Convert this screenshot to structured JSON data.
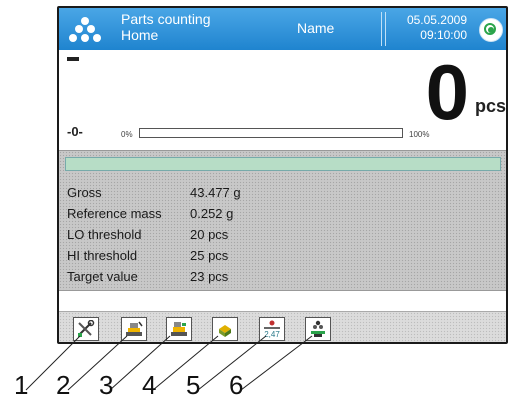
{
  "header": {
    "mode_title": "Parts counting",
    "mode_sub": "Home",
    "user_name": "Name",
    "date": "05.05.2009",
    "time": "09:10:00"
  },
  "weighing": {
    "value": "0",
    "unit": "pcs",
    "zero_indicator": "-0-",
    "bar_min_label": "0%",
    "bar_max_label": "100%",
    "bar_fill_fraction": 0
  },
  "info": [
    {
      "label": "Gross",
      "value": "43.477 g"
    },
    {
      "label": "Reference mass",
      "value": "0.252 g"
    },
    {
      "label": "LO threshold",
      "value": "20 pcs"
    },
    {
      "label": "HI threshold",
      "value": "25 pcs"
    },
    {
      "label": "Target value",
      "value": "23 pcs"
    }
  ],
  "softkeys": [
    {
      "icon": "settings-tools-icon"
    },
    {
      "icon": "reference-sample-icon"
    },
    {
      "icon": "reference-sample-alt-icon"
    },
    {
      "icon": "product-database-icon"
    },
    {
      "icon": "enter-mass-icon",
      "text": "2,47"
    },
    {
      "icon": "piece-count-icon"
    }
  ],
  "callouts": [
    "1",
    "2",
    "3",
    "4",
    "5",
    "6"
  ],
  "colors": {
    "header_blue": "#1f84cf",
    "status_green": "#2ba44b",
    "progress_green": "#b7ddc6"
  }
}
